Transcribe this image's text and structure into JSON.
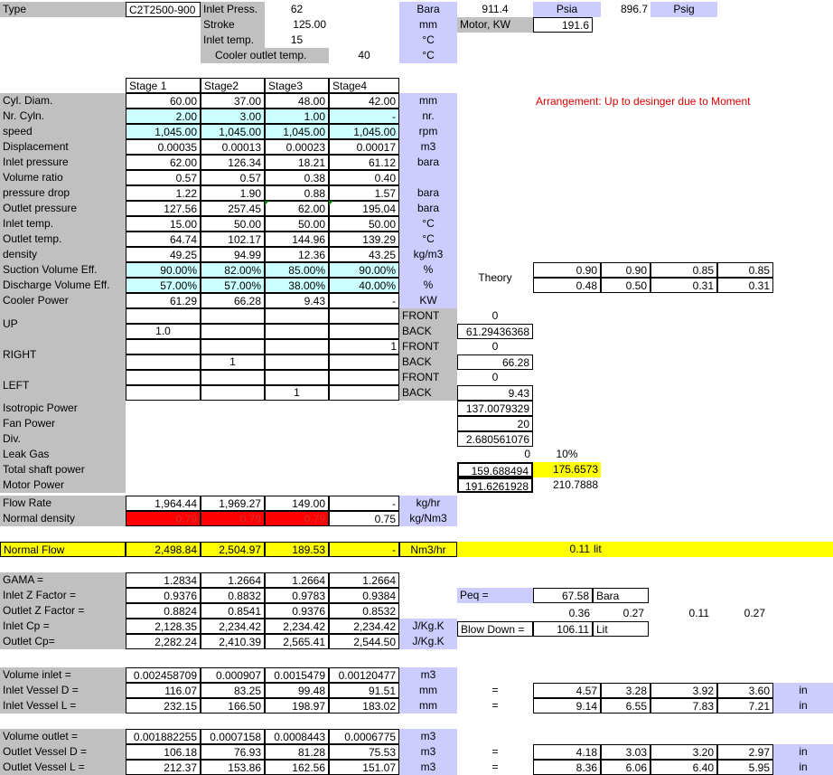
{
  "header": {
    "type_label": "Type",
    "type_value": "C2T2500-900",
    "inlet_press_label": "Inlet Press.",
    "inlet_press_value": "62",
    "stroke_label": "Stroke",
    "stroke_value": "125.00",
    "inlet_temp_label": "Inlet temp.",
    "inlet_temp_value": "15",
    "cooler_outlet_label": "Cooler outlet temp.",
    "cooler_outlet_value": "40",
    "unit_bara": "Bara",
    "unit_mm": "mm",
    "unit_c1": "°C",
    "unit_c2": "°C",
    "bara_value": "911.4",
    "psia_label": "Psia",
    "psig_value": "896.7",
    "psig_label": "Psig",
    "motor_label": "Motor, KW",
    "motor_value": "191.6"
  },
  "stages": [
    "Stage 1",
    "Stage2",
    "Stage3",
    "Stage4"
  ],
  "note": "Arrangement: Up to desinger due to Moment",
  "main_rows": [
    {
      "label": "Cyl. Diam.",
      "v": [
        "60.00",
        "37.00",
        "48.00",
        "42.00"
      ],
      "unit": "mm"
    },
    {
      "label": "Nr. Cyln.",
      "v": [
        "2.00",
        "3.00",
        "1.00",
        "-"
      ],
      "unit": "nr."
    },
    {
      "label": "speed",
      "v": [
        "1,045.00",
        "1,045.00",
        "1,045.00",
        "1,045.00"
      ],
      "unit": "rpm"
    },
    {
      "label": "Displacement",
      "v": [
        "0.00035",
        "0.00013",
        "0.00023",
        "0.00017"
      ],
      "unit": "m3"
    },
    {
      "label": "Inlet pressure",
      "v": [
        "62.00",
        "126.34",
        "18.21",
        "61.12"
      ],
      "unit": "bara"
    },
    {
      "label": "Volume ratio",
      "v": [
        "0.57",
        "0.57",
        "0.38",
        "0.40"
      ],
      "unit": ""
    },
    {
      "label": "pressure drop",
      "v": [
        "1.22",
        "1.90",
        "0.88",
        "1.57"
      ],
      "unit": "bara"
    },
    {
      "label": "Outlet pressure",
      "v": [
        "127.56",
        "257.45",
        "62.00",
        "195.04"
      ],
      "unit": "bara"
    },
    {
      "label": "Inlet temp.",
      "v": [
        "15.00",
        "50.00",
        "50.00",
        "50.00"
      ],
      "unit": "°C"
    },
    {
      "label": "Outlet temp.",
      "v": [
        "64.74",
        "102.17",
        "144.96",
        "139.29"
      ],
      "unit": "°C"
    },
    {
      "label": "density",
      "v": [
        "49.25",
        "94.99",
        "12.36",
        "43.25"
      ],
      "unit": "kg/m3"
    },
    {
      "label": "Suction Volume Eff.",
      "v": [
        "90.00%",
        "82.00%",
        "85.00%",
        "90.00%"
      ],
      "unit": "%"
    },
    {
      "label": "Discharge Volume Eff.",
      "v": [
        "57.00%",
        "57.00%",
        "38.00%",
        "40.00%"
      ],
      "unit": "%"
    },
    {
      "label": "Cooler Power",
      "v": [
        "61.29",
        "66.28",
        "9.43",
        "-"
      ],
      "unit": "KW"
    }
  ],
  "theory": {
    "label": "Theory",
    "row1": [
      "0.90",
      "0.90",
      "0.85",
      "0.85"
    ],
    "row2": [
      "0.48",
      "0.50",
      "0.31",
      "0.31"
    ]
  },
  "arrangement": {
    "up_label": "UP",
    "right_label": "RIGHT",
    "left_label": "LEFT",
    "up_value": "1.0",
    "right_s4": "1",
    "right_s2": "1",
    "left_s3": "1",
    "front": "FRONT",
    "back": "BACK",
    "up_front": "0",
    "up_back": "61.29436368",
    "right_front": "0",
    "right_back": "66.28",
    "left_front": "0",
    "left_back": "9.43"
  },
  "power": {
    "isotropic_label": "Isotropic Power",
    "isotropic_value": "137.0079329",
    "fan_label": "Fan Power",
    "fan_value": "20",
    "div_label": "Div.",
    "div_value": "2.680561076",
    "leak_label": "Leak Gas",
    "leak_value": "0",
    "leak_pct": "10%",
    "total_label": "Total shaft power",
    "total_value": "159.688494",
    "total_value2": "175.6573",
    "motor_label": "Motor Power",
    "motor_value": "191.6261928",
    "motor_value2": "210.7888"
  },
  "flow": {
    "flow_label": "Flow Rate",
    "flow_v": [
      "1,964.44",
      "1,969.27",
      "149.00",
      "-"
    ],
    "flow_unit": "kg/hr",
    "density_label": "Normal density",
    "density_v": [
      "0.79",
      "0.79",
      "0.79",
      "0.75"
    ],
    "density_unit": "kg/Nm3",
    "normal_label": "Normal Flow",
    "normal_v": [
      "2,498.84",
      "2,504.97",
      "189.53",
      "-"
    ],
    "normal_unit": "Nm3/hr",
    "normal_extra": "0.11",
    "normal_extra_unit": "lit"
  },
  "thermo": [
    {
      "label": "GAMA  =",
      "v": [
        "1.2834",
        "1.2664",
        "1.2664",
        "1.2664"
      ],
      "unit": ""
    },
    {
      "label": "Inlet Z Factor  =",
      "v": [
        "0.9376",
        "0.8832",
        "0.9783",
        "0.9384"
      ],
      "unit": ""
    },
    {
      "label": "Outlet Z Factor  =",
      "v": [
        "0.8824",
        "0.8541",
        "0.9376",
        "0.8532"
      ],
      "unit": ""
    },
    {
      "label": "Inlet Cp  =",
      "v": [
        "2,128.35",
        "2,234.42",
        "2,234.42",
        "2,234.42"
      ],
      "unit": "J/Kg.K"
    },
    {
      "label": "Outlet Cp=",
      "v": [
        "2,282.24",
        "2,410.39",
        "2,565.41",
        "2,544.50"
      ],
      "unit": "J/Kg.K"
    }
  ],
  "peq": {
    "label": "Peq =",
    "value": "67.58",
    "unit": "Bara",
    "row": [
      "0.36",
      "0.27",
      "0.11",
      "0.27"
    ],
    "blow_label": "Blow Down =",
    "blow_value": "106.11",
    "blow_unit": "Lit"
  },
  "vessels_in": [
    {
      "label": "Volume inlet =",
      "v": [
        "0.002458709",
        "0.000907",
        "0.0015479",
        "0.00120477"
      ],
      "unit": "m3",
      "eq": "",
      "r": [],
      "ru": ""
    },
    {
      "label": "Inlet Vessel D =",
      "v": [
        "116.07",
        "83.25",
        "99.48",
        "91.51"
      ],
      "unit": "mm",
      "eq": "=",
      "r": [
        "4.57",
        "3.28",
        "3.92",
        "3.60"
      ],
      "ru": "in"
    },
    {
      "label": "Inlet Vessel L =",
      "v": [
        "232.15",
        "166.50",
        "198.97",
        "183.02"
      ],
      "unit": "mm",
      "eq": "=",
      "r": [
        "9.14",
        "6.55",
        "7.83",
        "7.21"
      ],
      "ru": "in"
    }
  ],
  "vessels_out": [
    {
      "label": "Volume outlet =",
      "v": [
        "0.001882255",
        "0.0007158",
        "0.0008443",
        "0.0006775"
      ],
      "unit": "m3",
      "eq": "",
      "r": [],
      "ru": ""
    },
    {
      "label": "Outlet Vessel D =",
      "v": [
        "106.18",
        "76.93",
        "81.28",
        "75.53"
      ],
      "unit": "m3",
      "eq": "=",
      "r": [
        "4.18",
        "3.03",
        "3.20",
        "2.97"
      ],
      "ru": "in"
    },
    {
      "label": "Outlet Vessel L =",
      "v": [
        "212.37",
        "153.86",
        "162.56",
        "151.07"
      ],
      "unit": "m3",
      "eq": "=",
      "r": [
        "8.36",
        "6.06",
        "6.40",
        "5.95"
      ],
      "ru": "in"
    }
  ],
  "colors": {
    "label_bg": "#c0c0c0",
    "input_bg": "#ccffff",
    "unit_bg": "#ccccff",
    "highlight": "#ffff00",
    "alert": "#ff0000"
  }
}
